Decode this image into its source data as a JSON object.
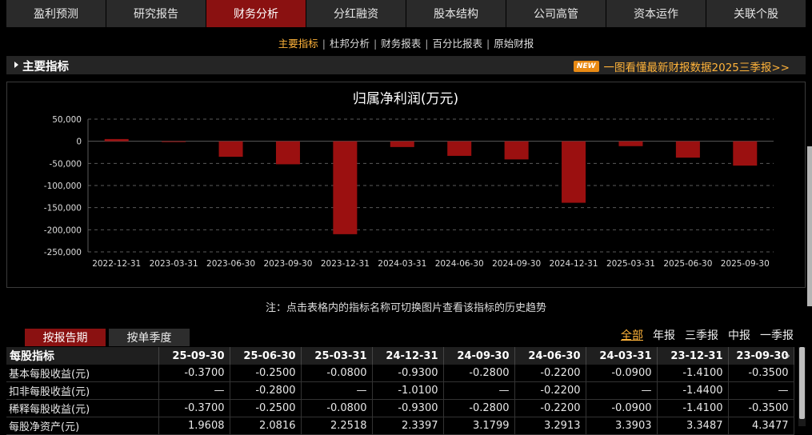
{
  "topnav": [
    "盈利预测",
    "研究报告",
    "财务分析",
    "分红融资",
    "股本结构",
    "公司高管",
    "资本运作",
    "关联个股"
  ],
  "topnav_active": 2,
  "subnav": [
    "主要指标",
    "杜邦分析",
    "财务报表",
    "百分比报表",
    "原始财报"
  ],
  "subnav_active": 0,
  "section": {
    "title": "主要指标",
    "new_badge": "NEW",
    "news_link": "一图看懂最新财报数据2025三季报>>"
  },
  "chart_data": {
    "type": "bar",
    "title": "归属净利润(万元)",
    "categories": [
      "2022-12-31",
      "2023-03-31",
      "2023-06-30",
      "2023-09-30",
      "2023-12-31",
      "2024-03-31",
      "2024-06-30",
      "2024-09-30",
      "2024-12-31",
      "2025-03-31",
      "2025-06-30",
      "2025-09-30"
    ],
    "values": [
      5000,
      -1000,
      -35000,
      -52000,
      -210000,
      -13000,
      -33000,
      -41000,
      -139000,
      -11000,
      -37000,
      -55000
    ],
    "ylim": [
      -250000,
      50000
    ],
    "yticks": [
      "50,000",
      "0",
      "-50,000",
      "-100,000",
      "-150,000",
      "-200,000",
      "-250,000"
    ],
    "ytick_values": [
      50000,
      0,
      -50000,
      -100000,
      -150000,
      -200000,
      -250000
    ],
    "bar_color": "#9b1010",
    "grid": true
  },
  "note": "注：点击表格内的指标名称可切换图片查看该指标的历史趋势",
  "period_tabs": [
    "按报告期",
    "按单季度"
  ],
  "period_active": 0,
  "filters": [
    "全部",
    "年报",
    "三季报",
    "中报",
    "一季报"
  ],
  "filter_active": 0,
  "more_icon": "»",
  "table": {
    "header": [
      "每股指标",
      "25-09-30",
      "25-06-30",
      "25-03-31",
      "24-12-31",
      "24-09-30",
      "24-06-30",
      "24-03-31",
      "23-12-31",
      "23-09-30"
    ],
    "rows": [
      [
        "基本每股收益(元)",
        "-0.3700",
        "-0.2500",
        "-0.0800",
        "-0.9300",
        "-0.2800",
        "-0.2200",
        "-0.0900",
        "-1.4100",
        "-0.3500"
      ],
      [
        "扣非每股收益(元)",
        "—",
        "-0.2800",
        "—",
        "-1.0100",
        "—",
        "-0.2200",
        "—",
        "-1.4400",
        "—"
      ],
      [
        "稀释每股收益(元)",
        "-0.3700",
        "-0.2500",
        "-0.0800",
        "-0.9300",
        "-0.2800",
        "-0.2200",
        "-0.0900",
        "-1.4100",
        "-0.3500"
      ],
      [
        "每股净资产(元)",
        "1.9608",
        "2.0816",
        "2.2518",
        "2.3397",
        "3.1799",
        "3.2913",
        "3.3903",
        "3.3487",
        "4.3477"
      ]
    ]
  }
}
